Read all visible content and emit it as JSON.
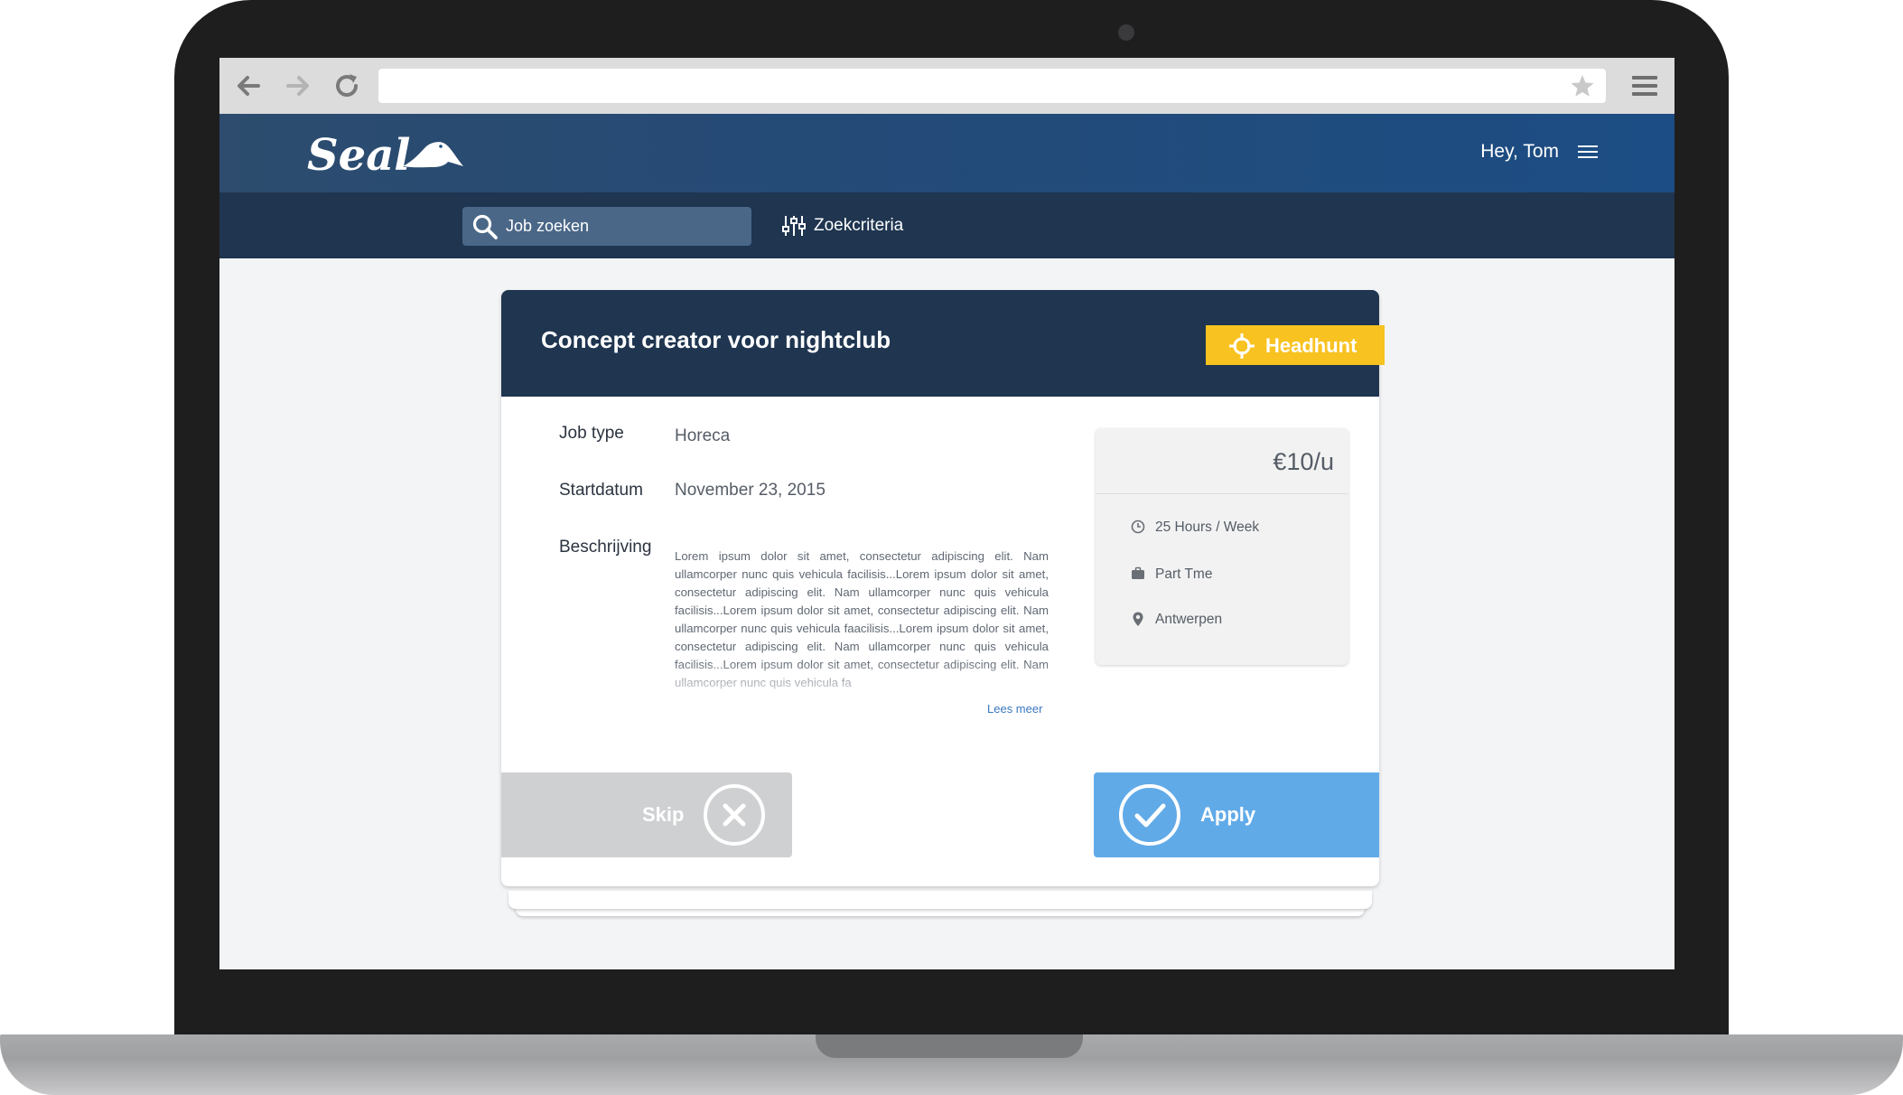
{
  "app": {
    "brand": "Seal",
    "greeting": "Hey, Tom"
  },
  "subnav": {
    "search_label": "Job zoeken",
    "criteria_label": "Zoekcriteria"
  },
  "job": {
    "title": "Concept creator voor nightclub",
    "headhunt_label": "Headhunt",
    "fields": {
      "job_type_label": "Job type",
      "job_type_value": "Horeca",
      "start_label": "Startdatum",
      "start_value": "November 23, 2015",
      "desc_label": "Beschrijving",
      "desc_value": "Lorem ipsum dolor sit amet, consectetur adipiscing elit. Nam ullamcorper nunc quis vehicula facilisis...Lorem ipsum dolor sit amet, consectetur adipiscing elit. Nam ullamcorper nunc quis vehicula facilisis...Lorem ipsum dolor sit amet, consectetur adipiscing elit. Nam ullamcorper nunc quis vehicula faacilisis...Lorem ipsum dolor sit amet, consectetur adipiscing elit. Nam ullamcorper nunc quis vehicula facilisis...Lorem ipsum dolor sit amet, consectetur adipiscing elit. Nam ullamcorper nunc quis vehicula fa",
      "read_more": "Lees meer"
    },
    "info": {
      "price": "€10/u",
      "hours": "25 Hours / Week",
      "type": "Part Tme",
      "location": "Antwerpen"
    }
  },
  "actions": {
    "skip": "Skip",
    "apply": "Apply"
  },
  "colors": {
    "header_dark": "#1f3550",
    "header_blue": "#1c4d84",
    "headhunt": "#f8c220",
    "apply": "#61aae8",
    "skip": "#cfd0d2"
  }
}
